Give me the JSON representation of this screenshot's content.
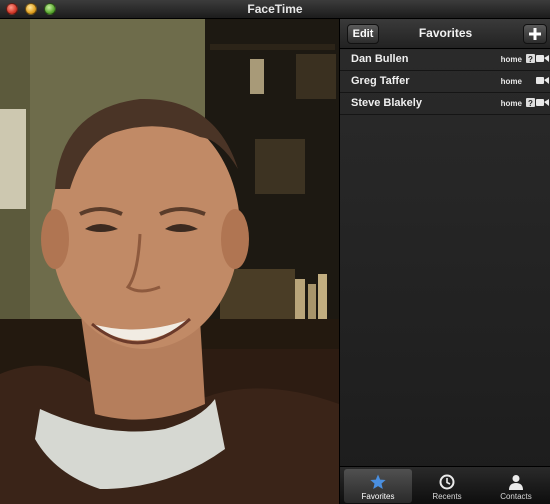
{
  "window": {
    "title": "FaceTime"
  },
  "panel": {
    "edit_label": "Edit",
    "title": "Favorites",
    "add_icon": "plus-icon"
  },
  "favorites": [
    {
      "name": "Dan Bullen",
      "label": "home",
      "icon": "video-camera-icon"
    },
    {
      "name": "Greg Taffer",
      "label": "home",
      "icon": "video-camera-icon"
    },
    {
      "name": "Steve Blakely",
      "label": "home",
      "icon": "video-camera-icon"
    }
  ],
  "tabs": [
    {
      "label": "Favorites",
      "icon": "star-icon",
      "active": true
    },
    {
      "label": "Recents",
      "icon": "clock-icon",
      "active": false
    },
    {
      "label": "Contacts",
      "icon": "person-icon",
      "active": false
    }
  ],
  "colors": {
    "active_tab_icon": "#4a8fe0",
    "panel_bg": "#2b2b2b",
    "text": "#f0f0f0"
  }
}
